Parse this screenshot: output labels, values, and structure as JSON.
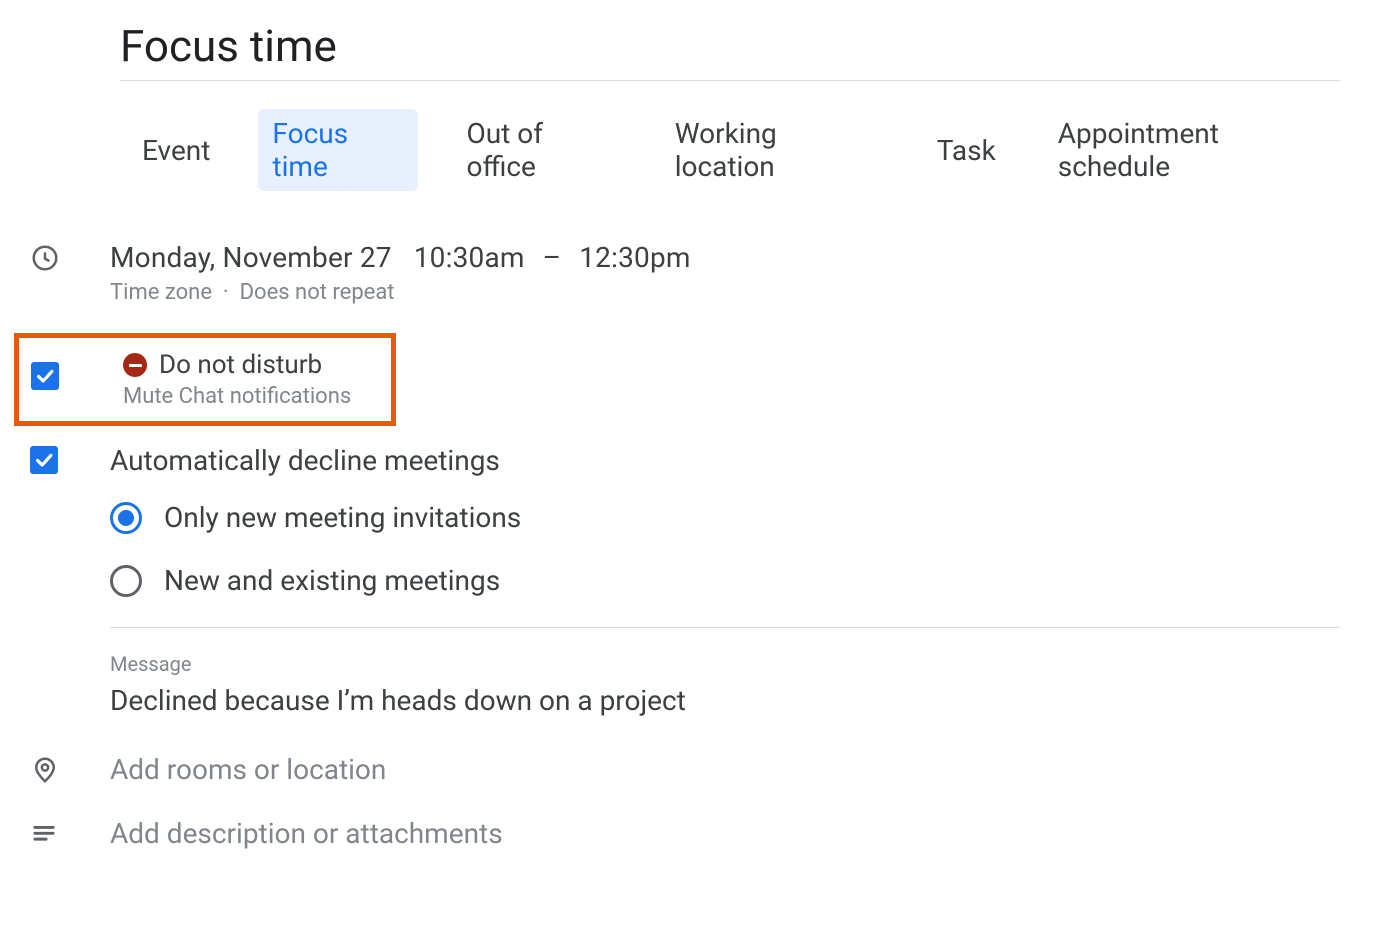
{
  "title": "Focus time",
  "tabs": {
    "event": "Event",
    "focus_time": "Focus time",
    "out_of_office": "Out of office",
    "working_location": "Working location",
    "task": "Task",
    "appointment_schedule": "Appointment schedule"
  },
  "datetime": {
    "date": "Monday, November 27",
    "start": "10:30am",
    "end": "12:30pm",
    "timezone_label": "Time zone",
    "separator": "·",
    "repeat_label": "Does not repeat"
  },
  "dnd": {
    "title": "Do not disturb",
    "subtitle": "Mute Chat notifications"
  },
  "auto_decline": {
    "title": "Automatically decline meetings",
    "option_new": "Only new meeting invitations",
    "option_all": "New and existing meetings"
  },
  "message": {
    "label": "Message",
    "value": "Declined because I’m heads down on a project"
  },
  "location": {
    "placeholder": "Add rooms or location"
  },
  "description": {
    "placeholder": "Add description or attachments"
  }
}
